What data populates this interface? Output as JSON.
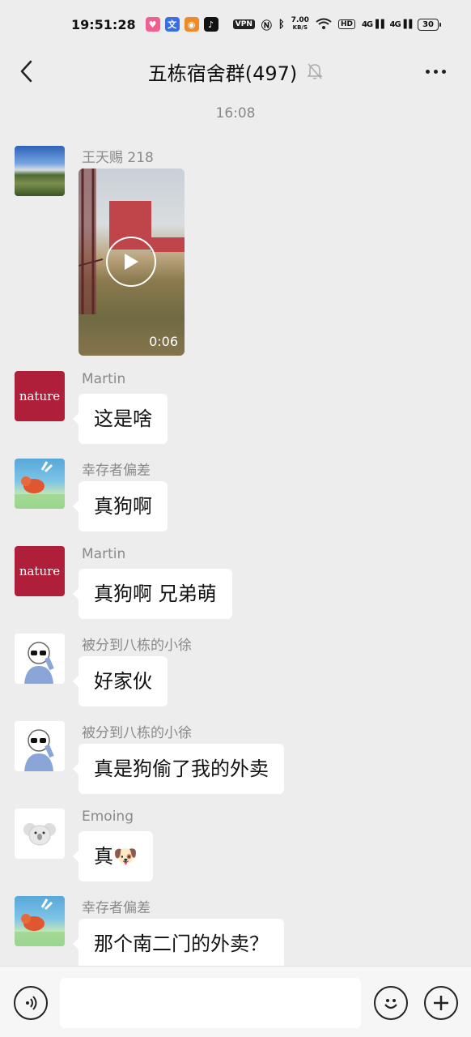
{
  "status_bar": {
    "time": "19:51:28",
    "vpn": "VPN",
    "speed_value": "7.00",
    "speed_unit": "KB/S",
    "hd": "HD",
    "signal1": "4G",
    "signal2": "4G",
    "battery": "30"
  },
  "header": {
    "title": "五栋宿舍群(497)"
  },
  "chat": {
    "timestamp": "16:08",
    "messages": [
      {
        "sender": "王天赐 218",
        "type": "video",
        "duration": "0:06",
        "avatar": "landscape"
      },
      {
        "sender": "Martin",
        "text": "这是啥",
        "avatar": "nature",
        "avatar_text": "nature"
      },
      {
        "sender": "幸存者偏差",
        "text": "真狗啊",
        "avatar": "crab"
      },
      {
        "sender": "Martin",
        "text": "真狗啊 兄弟萌",
        "avatar": "nature",
        "avatar_text": "nature"
      },
      {
        "sender": "被分到八栋的小徐",
        "text": "好家伙",
        "avatar": "sketch"
      },
      {
        "sender": "被分到八栋的小徐",
        "text": "真是狗偷了我的外卖",
        "avatar": "sketch"
      },
      {
        "sender": "Emoing",
        "text": "真",
        "emoji": "🐶",
        "avatar": "koala"
      },
      {
        "sender": "幸存者偏差",
        "text": "那个南二门的外卖？",
        "avatar": "crab"
      }
    ]
  },
  "input_bar": {
    "placeholder": ""
  },
  "colors": {
    "background": "#ededed",
    "bubble": "#ffffff",
    "nature_red": "#b01f3a",
    "sender_gray": "#8a8a8a"
  }
}
